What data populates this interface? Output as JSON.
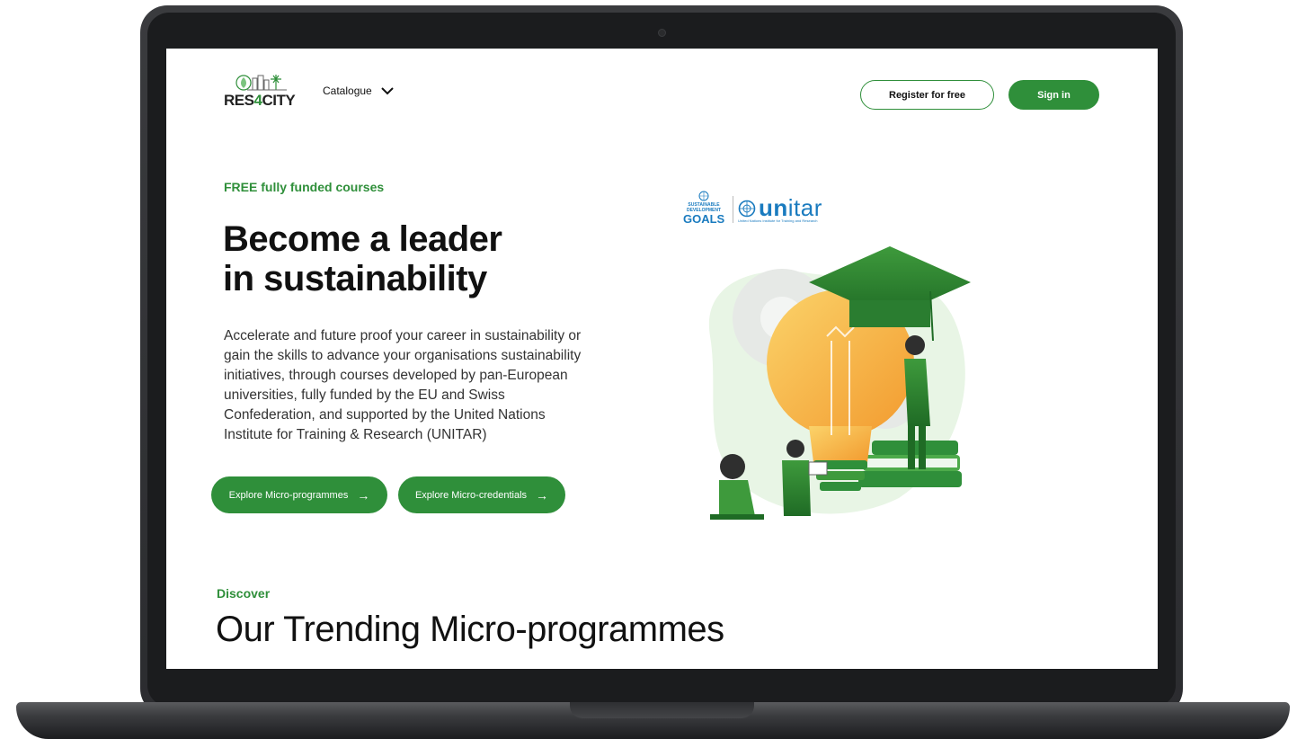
{
  "header": {
    "logo_text_a": "RES",
    "logo_text_b": "4",
    "logo_text_c": "CITY",
    "catalogue_label": "Catalogue",
    "register_label": "Register for free",
    "signin_label": "Sign in"
  },
  "hero": {
    "eyebrow": "FREE fully funded courses",
    "title_line1": "Become a leader",
    "title_line2": "in sustainability",
    "description": "Accelerate and future proof your career in sustainability or gain the skills to advance your organisations sustainability initiatives, through courses developed by pan-European universities, fully funded by the EU and Swiss Confederation, and supported by the United Nations Institute for Training & Research (UNITAR)",
    "btn_micro_programmes": "Explore Micro-programmes",
    "btn_micro_credentials": "Explore Micro-credentials"
  },
  "partners": {
    "sdg_line1": "SUSTAINABLE",
    "sdg_line2": "DEVELOPMENT",
    "sdg_goals": "GOALS",
    "unitar_a": "un",
    "unitar_b": "itar",
    "unitar_sub": "United Nations Institute for Training and Research"
  },
  "trending": {
    "eyebrow": "Discover",
    "title": "Our Trending Micro-programmes"
  },
  "colors": {
    "brand_green": "#2f8f3a",
    "unitar_blue": "#1a7bbf",
    "bulb_yellow": "#f6b443"
  }
}
